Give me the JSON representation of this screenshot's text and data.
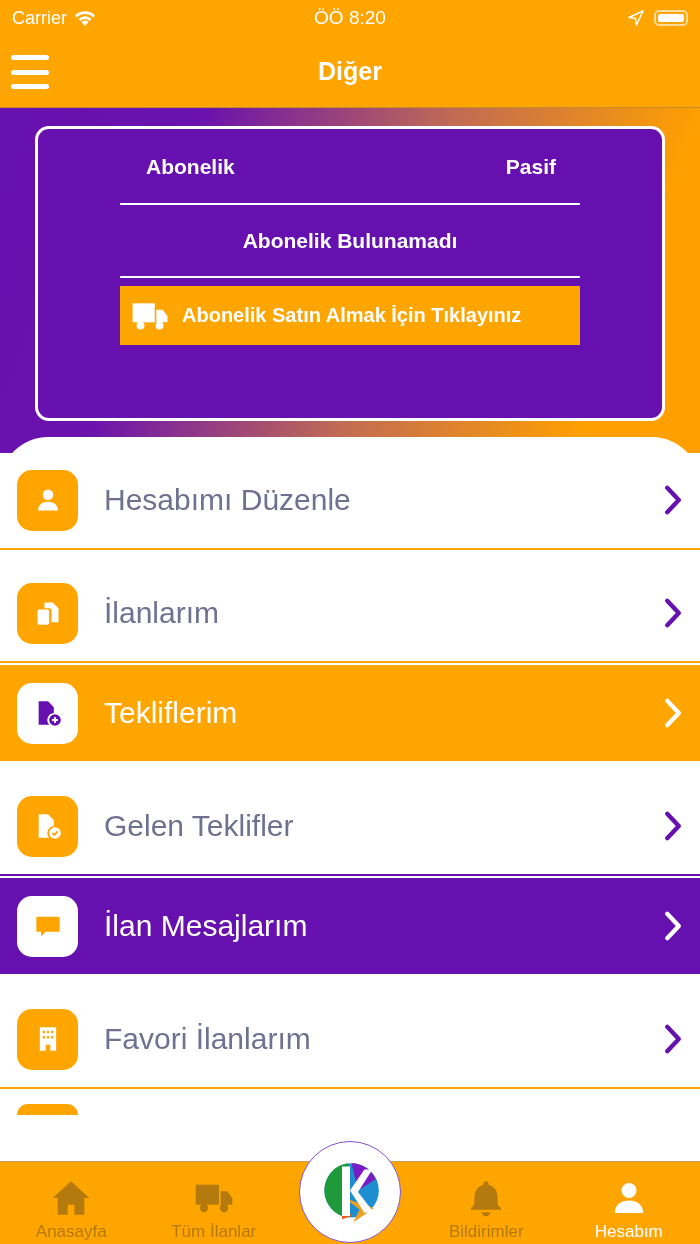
{
  "status_bar": {
    "carrier": "Carrier",
    "time": "ÖÖ 8:20"
  },
  "nav_bar": {
    "title": "Diğer"
  },
  "subscription": {
    "label": "Abonelik",
    "state": "Pasif",
    "message": "Abonelik Bulunamadı",
    "button": "Abonelik Satın Almak İçin Tıklayınız"
  },
  "menu": [
    {
      "kind": "person",
      "label": "Hesabımı Düzenle"
    },
    {
      "kind": "documents",
      "label": "İlanlarım"
    },
    {
      "kind": "offer-add",
      "label": "Tekliflerim"
    },
    {
      "kind": "offer-check",
      "label": "Gelen Teklifler"
    },
    {
      "kind": "chat",
      "label": "İlan Mesajlarım"
    },
    {
      "kind": "building",
      "label": "Favori İlanlarım"
    },
    {
      "kind": "blank"
    }
  ],
  "tab_bar": [
    {
      "kind": "home",
      "label": "Anasayfa",
      "selected": false
    },
    {
      "kind": "truck",
      "label": "Tüm İlanlar",
      "selected": false
    },
    {
      "kind": "logo"
    },
    {
      "kind": "bell",
      "label": "Bildirimler",
      "selected": false
    },
    {
      "kind": "person",
      "label": "Hesabım",
      "selected": true
    }
  ]
}
